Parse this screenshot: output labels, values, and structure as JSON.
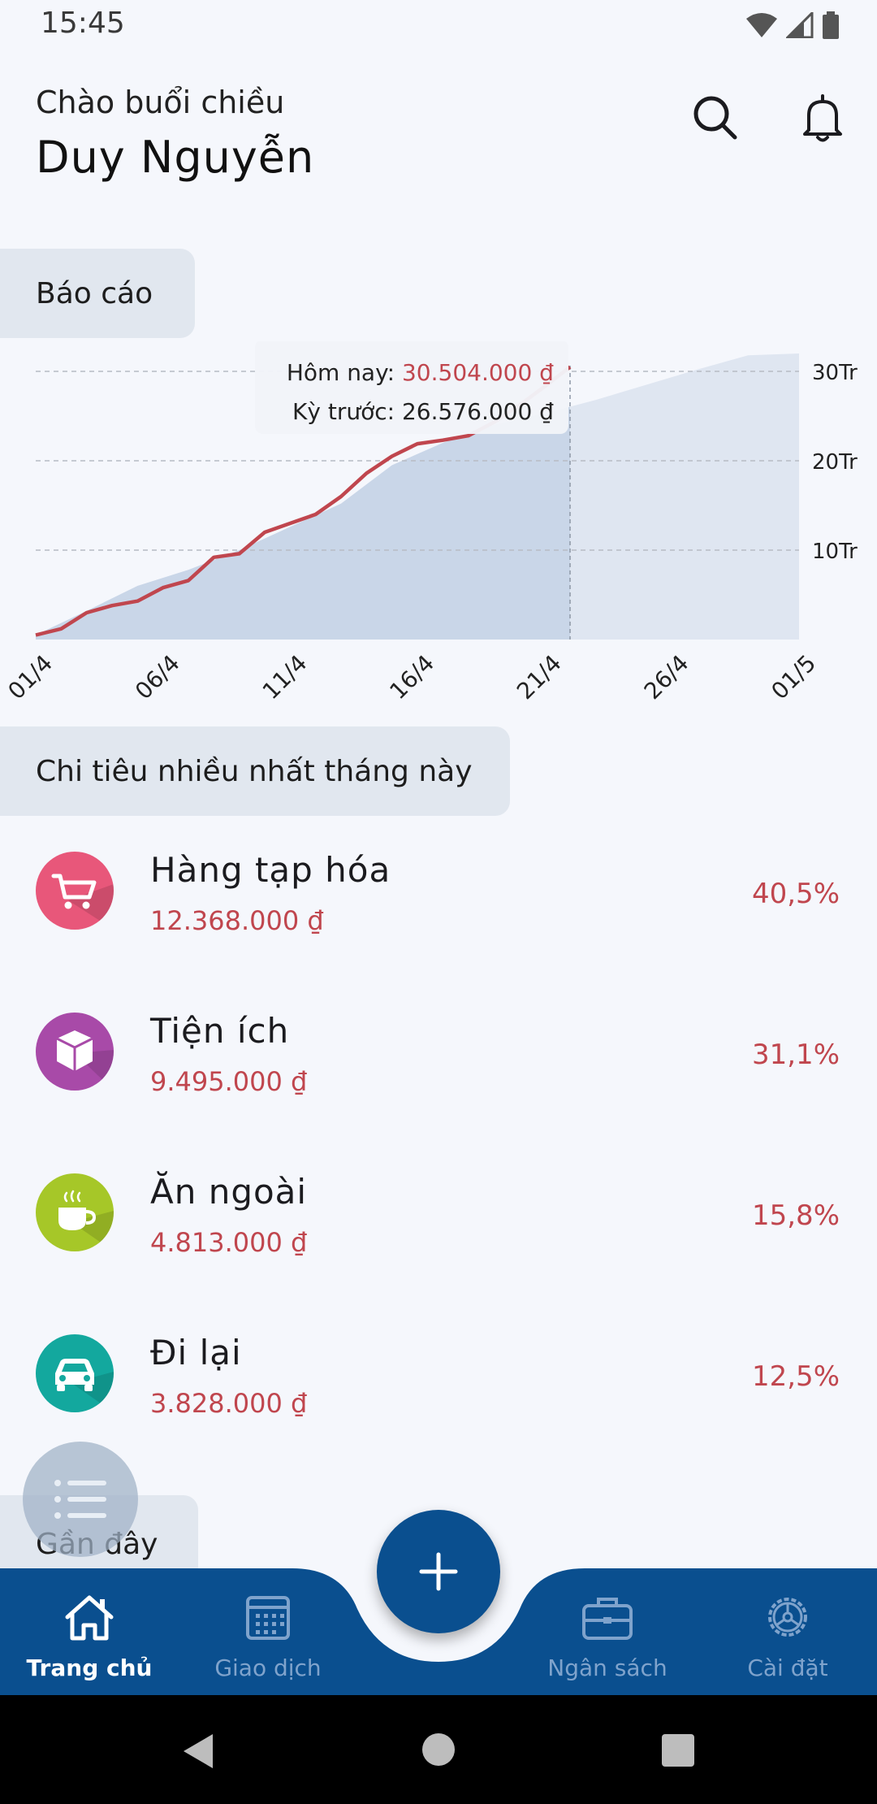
{
  "status_bar": {
    "time": "15:45"
  },
  "header": {
    "greeting": "Chào buổi chiều",
    "user_name": "Duy Nguyễn",
    "search_icon": "search-icon",
    "bell_icon": "bell-icon"
  },
  "report": {
    "section_label": "Báo cáo",
    "tooltip": {
      "today_label": "Hôm nay: ",
      "today_value": "30.504.000 ₫",
      "prev_label": "Kỳ trước: ",
      "prev_value": "26.576.000 ₫"
    }
  },
  "chart_data": {
    "type": "area",
    "x_tick_labels": [
      "01/4",
      "06/4",
      "11/4",
      "16/4",
      "21/4",
      "26/4",
      "01/5"
    ],
    "y_tick_labels": [
      "10Tr",
      "20Tr",
      "30Tr"
    ],
    "y_ticks": [
      10,
      20,
      30
    ],
    "ylim": [
      0,
      32
    ],
    "xlim": [
      0,
      30
    ],
    "grid": true,
    "series": [
      {
        "role": "current",
        "color": "#c0464e",
        "x": [
          0,
          1,
          2,
          3,
          4,
          5,
          6,
          7,
          8,
          9,
          10,
          11,
          12,
          13,
          14,
          15,
          16,
          17,
          18,
          19,
          20,
          21
        ],
        "y": [
          0.5,
          1.2,
          3.0,
          3.8,
          4.3,
          5.8,
          6.6,
          9.2,
          9.6,
          12.0,
          13.0,
          14.0,
          16.0,
          18.6,
          20.5,
          21.9,
          22.3,
          22.8,
          24.3,
          26.2,
          28.3,
          30.5
        ]
      },
      {
        "role": "previous",
        "color": "#d0dae8",
        "x": [
          0,
          2,
          4,
          6,
          8,
          10,
          12,
          14,
          16,
          18,
          20,
          22,
          24,
          26,
          28,
          30
        ],
        "y": [
          0.5,
          3.2,
          6.0,
          7.8,
          10.0,
          12.6,
          15.2,
          19.5,
          22.0,
          24.0,
          25.3,
          26.8,
          28.5,
          30.2,
          31.8,
          32.0
        ]
      }
    ],
    "marker_x": 21
  },
  "top_spending": {
    "section_label": "Chi tiêu nhiều nhất tháng này",
    "items": [
      {
        "name": "Hàng tạp hóa",
        "amount": "12.368.000 ₫",
        "percent": "40,5%",
        "icon": "shopping-cart-icon",
        "color": "#e8577a"
      },
      {
        "name": "Tiện ích",
        "amount": "9.495.000 ₫",
        "percent": "31,1%",
        "icon": "box-icon",
        "color": "#a84aa8"
      },
      {
        "name": "Ăn ngoài",
        "amount": "4.813.000 ₫",
        "percent": "15,8%",
        "icon": "coffee-cup-icon",
        "color": "#a6c728"
      },
      {
        "name": "Đi lại",
        "amount": "3.828.000 ₫",
        "percent": "12,5%",
        "icon": "car-icon",
        "color": "#13a89e"
      }
    ]
  },
  "recent": {
    "section_label": "Gần đây"
  },
  "bottom_nav": {
    "home": "Trang chủ",
    "transactions": "Giao dịch",
    "budget": "Ngân sách",
    "settings": "Cài đặt",
    "bar_color": "#0a4f8f"
  }
}
